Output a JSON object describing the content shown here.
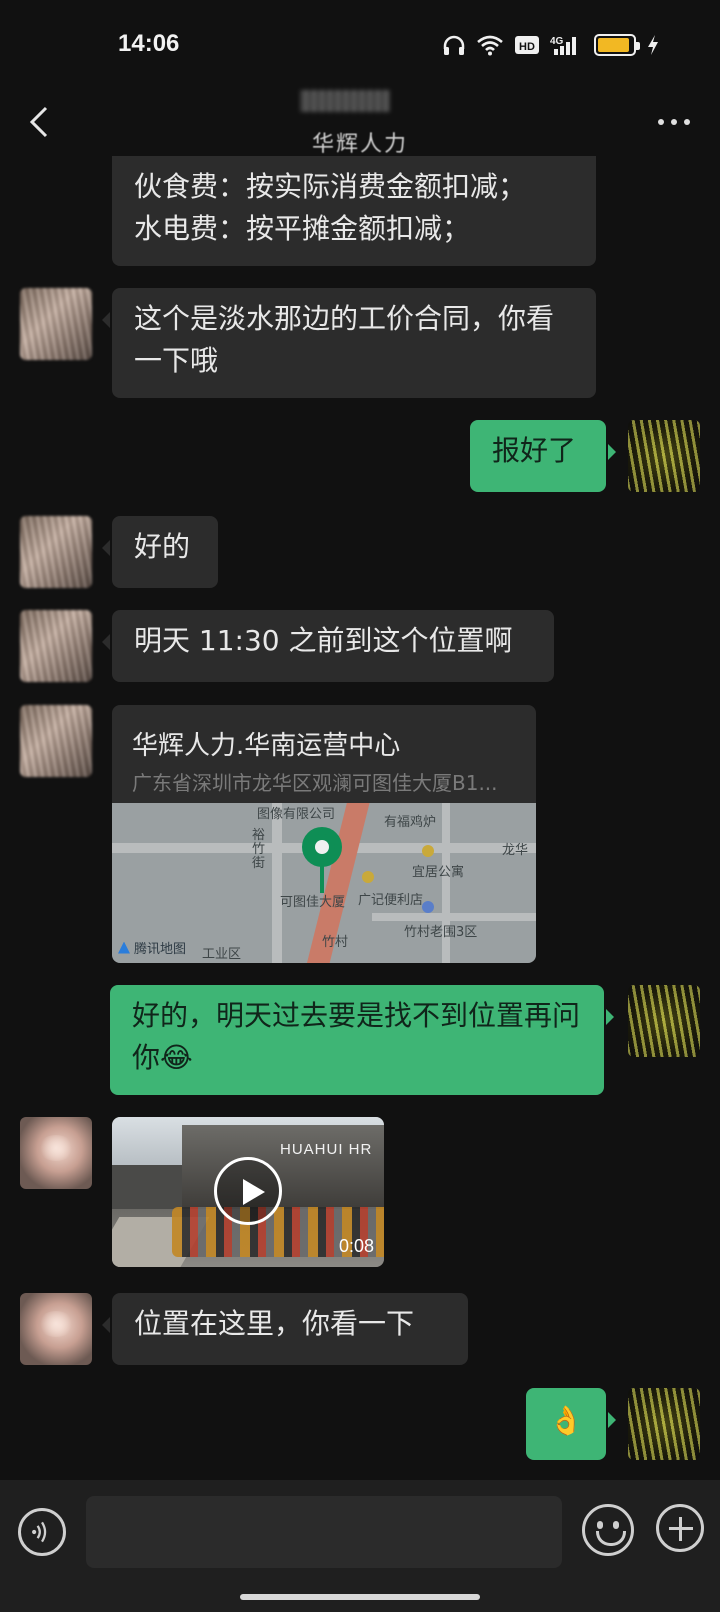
{
  "status_bar": {
    "time": "14:06",
    "network": "4G",
    "hd": "HD",
    "battery_level": 0.9
  },
  "header": {
    "title": "华辉人力"
  },
  "messages": [
    {
      "side": "in",
      "lines": [
        "伙食费：按实际消费金额扣减；",
        "水电费：按平摊金额扣减；"
      ]
    },
    {
      "side": "in",
      "text": "这个是淡水那边的工价合同，你看一下哦"
    },
    {
      "side": "out",
      "text": "报好了"
    },
    {
      "side": "in",
      "text": "好的"
    },
    {
      "side": "in",
      "text": "明天 11:30 之前到这个位置啊"
    },
    {
      "side": "in",
      "type": "location",
      "title": "华辉人力.华南运营中心",
      "address": "广东省深圳市龙华区观澜可图佳大厦B1...",
      "map_labels": [
        "图像有限公司",
        "有福鸡炉",
        "裕竹街",
        "宜居公寓",
        "龙华",
        "可图佳大厦",
        "广记便利店",
        "竹村老围3区",
        "竹村",
        "工业区"
      ],
      "brand": "腾讯地图"
    },
    {
      "side": "out",
      "text": "好的，明天过去要是找不到位置再问你😂"
    },
    {
      "side": "in",
      "type": "video",
      "duration": "0:08",
      "sign": "HUAHUI HR"
    },
    {
      "side": "in",
      "text": "位置在这里，你看一下"
    },
    {
      "side": "out",
      "text": "👌"
    }
  ],
  "input": {
    "placeholder": ""
  }
}
